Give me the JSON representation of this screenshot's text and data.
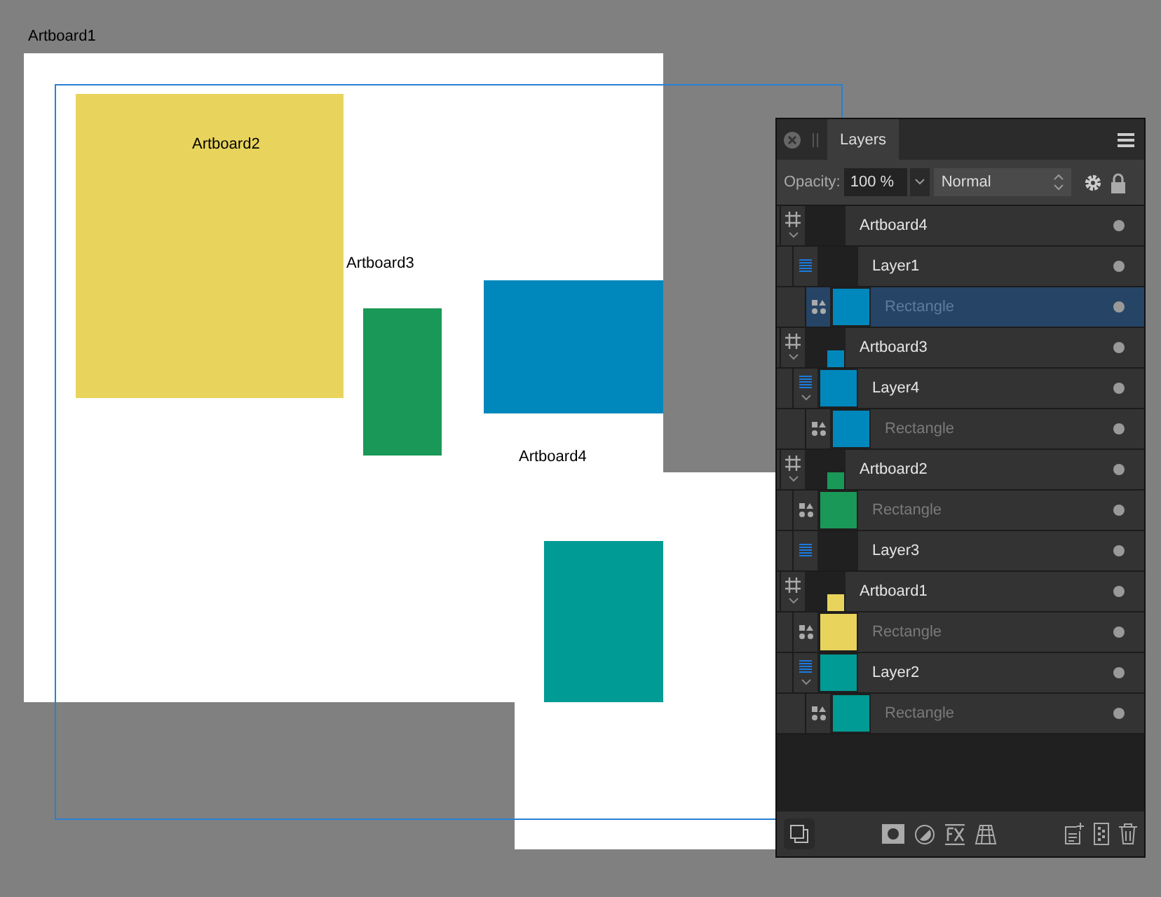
{
  "canvas": {
    "artboards": [
      {
        "label": "Artboard1"
      },
      {
        "label": "Artboard2"
      },
      {
        "label": "Artboard3"
      },
      {
        "label": "Artboard4"
      }
    ],
    "shapes": [
      {
        "color": "#e8d45c"
      },
      {
        "color": "#1a9857"
      },
      {
        "color": "#0088bd"
      },
      {
        "color": "#009b94"
      }
    ]
  },
  "panel": {
    "tab": "Layers",
    "opacity_label": "Opacity:",
    "opacity": "100 %",
    "blend_mode": "Normal",
    "locked": true,
    "layers": [
      {
        "name": "Artboard4",
        "kind": "artboard",
        "selected": false,
        "expanded": true,
        "children": [
          {
            "name": "Layer1",
            "kind": "layer",
            "selected": false,
            "children": [
              {
                "name": "Rectangle",
                "kind": "shape",
                "selected": true,
                "color": "#0088bd"
              }
            ]
          }
        ]
      },
      {
        "name": "Artboard3",
        "kind": "artboard",
        "selected": false,
        "expanded": true,
        "color": "#0088bd",
        "children": [
          {
            "name": "Layer4",
            "kind": "layer",
            "selected": false,
            "expanded": true,
            "color": "#0088bd",
            "children": [
              {
                "name": "Rectangle",
                "kind": "shape",
                "selected": false,
                "color": "#0088bd"
              }
            ]
          }
        ]
      },
      {
        "name": "Artboard2",
        "kind": "artboard",
        "selected": false,
        "expanded": true,
        "color": "#1a9857",
        "children": [
          {
            "name": "Rectangle",
            "kind": "shape",
            "selected": false,
            "color": "#1a9857"
          },
          {
            "name": "Layer3",
            "kind": "layer",
            "selected": false
          }
        ]
      },
      {
        "name": "Artboard1",
        "kind": "artboard",
        "selected": false,
        "expanded": true,
        "color": "#e8d45c",
        "children": [
          {
            "name": "Rectangle",
            "kind": "shape",
            "selected": false,
            "color": "#e8d45c"
          },
          {
            "name": "Layer2",
            "kind": "layer",
            "selected": false,
            "expanded": true,
            "color": "#009b94",
            "children": [
              {
                "name": "Rectangle",
                "kind": "shape",
                "selected": false,
                "color": "#009b94"
              }
            ]
          }
        ]
      }
    ]
  }
}
